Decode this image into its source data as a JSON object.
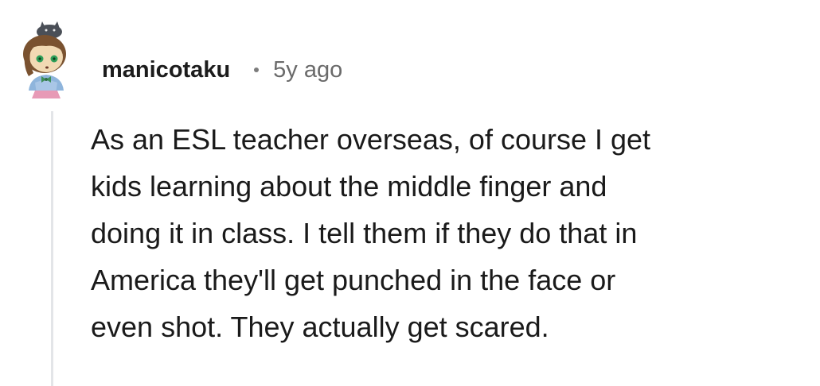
{
  "comment": {
    "author": "manicotaku",
    "separator": "•",
    "timestamp": "5y ago",
    "avatar_icon": "snoo-avatar-icon",
    "body_lines": [
      "As an ESL teacher overseas, of course I get",
      "kids learning about the middle finger and",
      "doing it in class. I tell them if they do that in",
      "America they'll get punched in the face or",
      "even shot. They actually get scared."
    ]
  },
  "colors": {
    "username": "#1c1c1c",
    "timestamp": "#6a6a6a",
    "body": "#1a1a1a",
    "thread_line": "#e3e5e8"
  }
}
